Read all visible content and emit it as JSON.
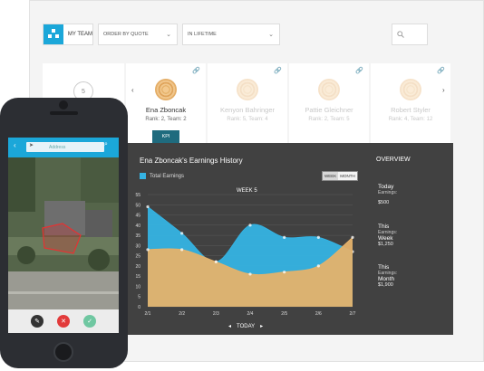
{
  "toolbar": {
    "team_label": "MY TEAM",
    "order_select": "ORDER BY QUOTE",
    "period_select": "IN LIFETIME"
  },
  "team_count": "5",
  "members": [
    {
      "name": "Ena Zboncak",
      "rank": "Rank: 2, Team: 2",
      "kpi": "KPI"
    },
    {
      "name": "Kenyon Bahringer",
      "rank": "Rank: 5, Team: 4"
    },
    {
      "name": "Pattie Gleichner",
      "rank": "Rank: 2, Team: 5"
    },
    {
      "name": "Robert Styler",
      "rank": "Rank: 4, Team: 12"
    }
  ],
  "chart_panel": {
    "title": "Ena Zboncak's Earnings History",
    "toggle": {
      "week": "WEEK",
      "month": "MONTH"
    },
    "week_label": "WEEK 5",
    "nav_label": "TODAY"
  },
  "overview": {
    "title": "OVERVIEW",
    "today_big": "Today",
    "today_small": "Earnings:",
    "today_value": "$500",
    "week_big1": "This",
    "week_small": "Earnings:",
    "week_big2": "Week",
    "week_value": "$1,250",
    "month_big1": "This",
    "month_small": "Earnings:",
    "month_big2": "Month",
    "month_value": "$1,900"
  },
  "chart_data": {
    "type": "area",
    "x": [
      "2/1",
      "2/2",
      "2/3",
      "2/4",
      "2/5",
      "2/6",
      "2/7"
    ],
    "series": [
      {
        "name": "Total Earnings",
        "values": [
          49,
          36,
          22,
          40,
          34,
          34,
          27
        ],
        "color": "#35b3e3"
      },
      {
        "name": "",
        "values": [
          28,
          28,
          22,
          16,
          17,
          20,
          34
        ],
        "color": "#e5b26b"
      }
    ],
    "yticks": [
      0,
      5,
      10,
      15,
      20,
      25,
      30,
      35,
      40,
      45,
      50,
      55
    ],
    "ylim": [
      0,
      55
    ],
    "legend": "top-left"
  },
  "phone": {
    "address_placeholder": "Address"
  },
  "colors": {
    "accent": "#1ba7d9",
    "panel": "#414141",
    "earnings": "#35b3e3",
    "secondary": "#e5b26b"
  }
}
